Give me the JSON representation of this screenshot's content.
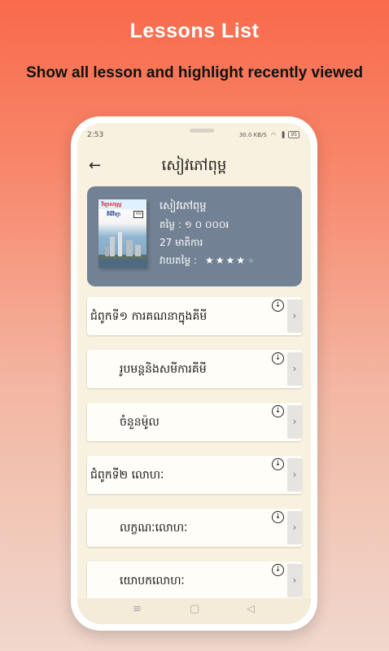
{
  "promo": {
    "headline": "Lessons List",
    "subheadline": "Show all lesson and highlight recently viewed"
  },
  "status_bar": {
    "time": "2:53",
    "speed": "30.0 KB/S",
    "battery": "95"
  },
  "app_bar": {
    "back_icon": "arrow-left-icon",
    "title": "សៀវភៅពុម្ព"
  },
  "book": {
    "title": "សៀវភៅពុម្ព",
    "price": "តម្លៃ : ១ ០ ០០០៛",
    "lessons_count": "27 មាតិការ",
    "rating_label": "វាយតម្លៃ :",
    "rating": 4,
    "rating_max": 5,
    "cover": {
      "title": "វិទ្យាសាស្ត្រ",
      "subtitle": "គីមីវិទ្យា",
      "badge": "១២"
    }
  },
  "lessons": [
    {
      "label": "ជំពូកទី១ ការគណនាក្នុងគីមី",
      "level": "chapter"
    },
    {
      "label": "រូបមន្តនិងសមីការគីមី",
      "level": "sub"
    },
    {
      "label": "ចំនួនម៉ូល",
      "level": "sub"
    },
    {
      "label": "ជំពូកទី២ លោហៈ",
      "level": "chapter"
    },
    {
      "label": "លក្ខណៈលោហៈ",
      "level": "sub"
    },
    {
      "label": "យោបកលោហៈ",
      "level": "sub"
    }
  ],
  "icons": {
    "download": "download-circle-icon",
    "chevron": "chevron-right-icon"
  },
  "colors": {
    "background_top": "#f96a4b",
    "card": "#728193",
    "screen": "#f9f1df"
  }
}
